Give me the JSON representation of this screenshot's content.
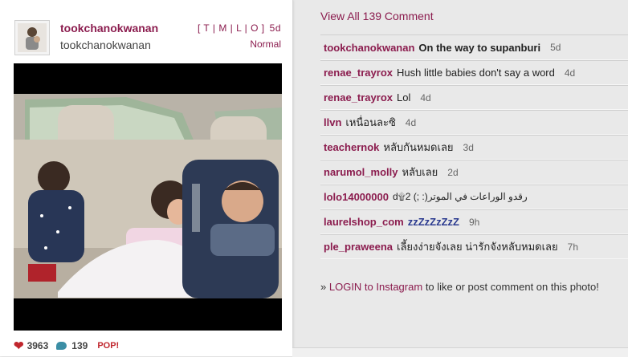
{
  "post": {
    "username": "tookchanokwanan",
    "full_name": "tookchanokwanan",
    "filter_links": "[ T | M | L | O ]",
    "age": "5d",
    "filter_name": "Normal",
    "likes": "3963",
    "comments": "139",
    "pop": "POP!"
  },
  "comments_panel": {
    "view_all": "View All 139 Comment",
    "items": [
      {
        "user": "tookchanokwanan",
        "text": "On the way to supanburi",
        "age": "5d",
        "bold": true
      },
      {
        "user": "renae_trayrox",
        "text": "Hush little babies don't say a word",
        "age": "4d"
      },
      {
        "user": "renae_trayrox",
        "text": "Lol",
        "age": "4d"
      },
      {
        "user": "llvn",
        "text": "เหนื่อนละซิ",
        "age": "4d"
      },
      {
        "user": "teachernok",
        "text": "หลับกันหมดเลย",
        "age": "3d"
      },
      {
        "user": "narumol_molly",
        "text": "หลับเลย",
        "age": "2d"
      },
      {
        "user": "lolo14000000",
        "text": "d۩رقدو الوراعات في الموتر(: ;) 2",
        "age": ""
      },
      {
        "user": "laurelshop_com",
        "text": "zzZzZzZzZ",
        "age": "9h",
        "zz": true
      },
      {
        "user": "ple_praweena",
        "text": "เลี้ยงง่ายจังเลย น่ารักจังหลับหมดเลย",
        "age": "7h"
      }
    ],
    "login_prefix": "»",
    "login_link": "LOGIN to Instagram",
    "login_suffix": "to like or post comment on this photo!"
  },
  "icons": {
    "heart": "heart-icon",
    "comment": "comment-bubble-icon"
  },
  "colors": {
    "accent": "#8b1c4e",
    "heart": "#c0262d",
    "bubble": "#3b8ea5"
  }
}
